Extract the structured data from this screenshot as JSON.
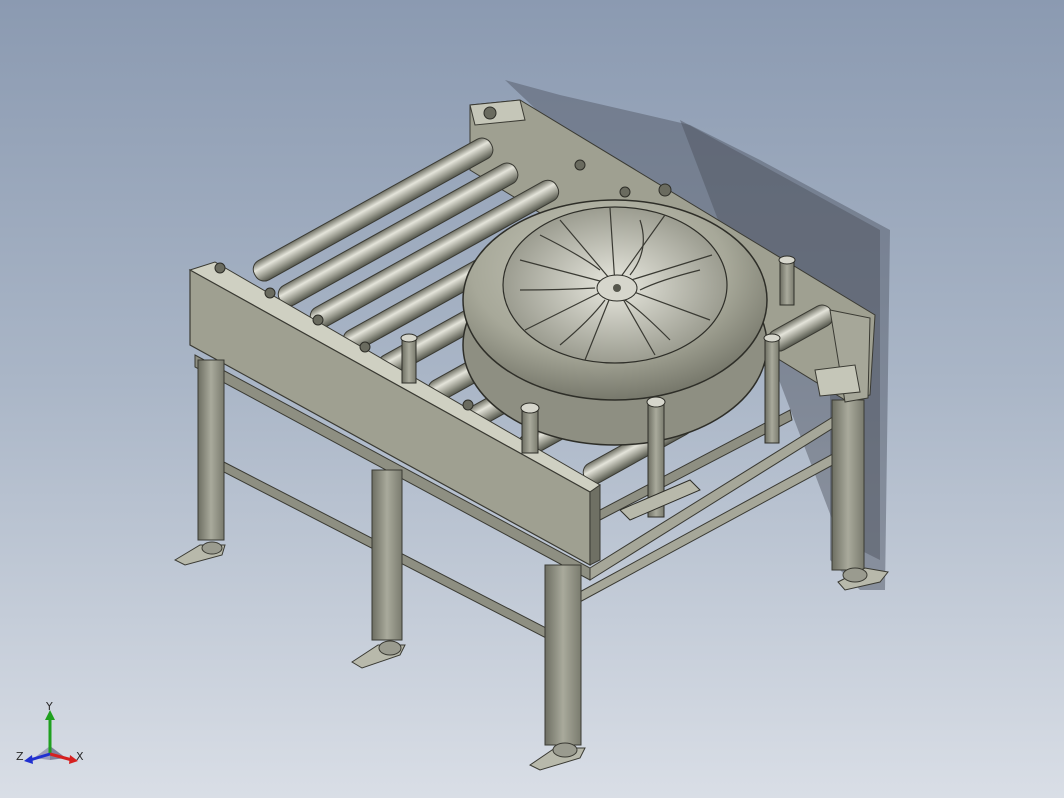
{
  "viewport": {
    "background_top": "#8b9ab1",
    "background_bottom": "#d9dee6",
    "model": "tire-roller-conveyor-assembly"
  },
  "triad": {
    "x_label": "X",
    "y_label": "Y",
    "z_label": "Z",
    "x_color": "#d62020",
    "y_color": "#1fa01f",
    "z_color": "#2030d0"
  }
}
